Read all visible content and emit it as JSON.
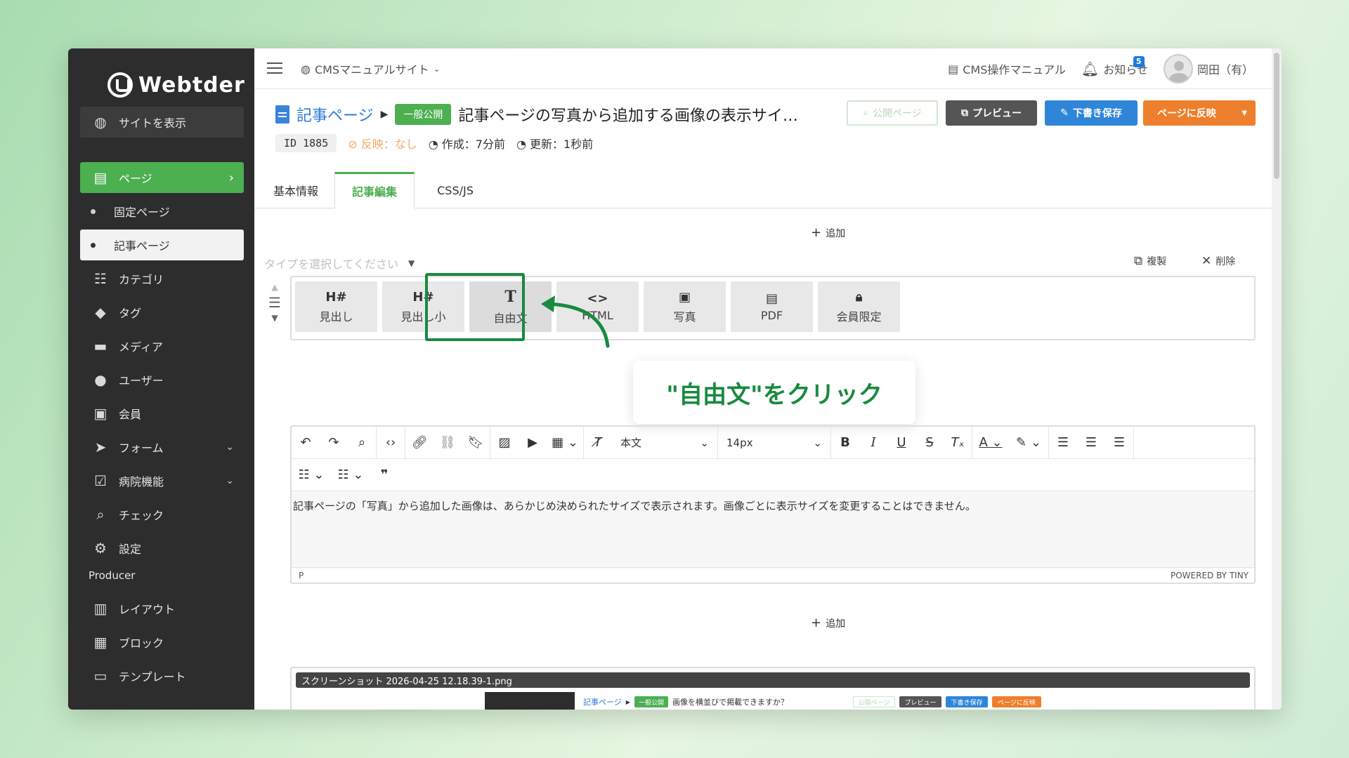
{
  "brand": {
    "name": "Webtder"
  },
  "sidebar": {
    "site_view": "サイトを表示",
    "items": [
      {
        "label": "ページ",
        "icon": "page-icon"
      },
      {
        "label": "固定ページ"
      },
      {
        "label": "記事ページ"
      },
      {
        "label": "カテゴリ",
        "icon": "category-icon"
      },
      {
        "label": "タグ",
        "icon": "tag-icon"
      },
      {
        "label": "メディア",
        "icon": "folder-icon"
      },
      {
        "label": "ユーザー",
        "icon": "user-icon"
      },
      {
        "label": "会員",
        "icon": "member-card-icon"
      },
      {
        "label": "フォーム",
        "icon": "send-icon"
      },
      {
        "label": "病院機能",
        "icon": "clipboard-check-icon"
      },
      {
        "label": "チェック",
        "icon": "search-icon"
      },
      {
        "label": "設定",
        "icon": "gear-icon"
      }
    ],
    "producer_label": "Producer",
    "producer_items": [
      {
        "label": "レイアウト",
        "icon": "layout-icon"
      },
      {
        "label": "ブロック",
        "icon": "blocks-icon"
      },
      {
        "label": "テンプレート",
        "icon": "monitor-icon"
      }
    ]
  },
  "topbar": {
    "site_name": "CMSマニュアルサイト",
    "manual": "CMS操作マニュアル",
    "notice": "お知らせ",
    "notice_count": "5",
    "user": "岡田（有）"
  },
  "header": {
    "crumb": "記事ページ",
    "status": "一般公開",
    "title": "記事ページの写真から追加する画像の表示サイ…",
    "buttons": {
      "public_page": "公開ページ",
      "preview": "プレビュー",
      "save_draft": "下書き保存",
      "reflect": "ページに反映"
    },
    "id": "ID 1885",
    "reflect_state": "反映：なし",
    "created": "作成：7分前",
    "updated": "更新：1秒前"
  },
  "tabs": [
    "基本情報",
    "記事編集",
    "CSS/JS"
  ],
  "editor_area": {
    "add": "追加",
    "type_placeholder": "タイプを選択してください",
    "copy": "複製",
    "delete": "削除",
    "block_types": [
      {
        "icon": "H#",
        "label": "見出し"
      },
      {
        "icon": "H#",
        "label": "見出し小"
      },
      {
        "icon": "T",
        "label": "自由文"
      },
      {
        "icon": "<>",
        "label": "HTML"
      },
      {
        "icon": "photo-file-icon",
        "label": "写真"
      },
      {
        "icon": "pdf-file-icon",
        "label": "PDF"
      },
      {
        "icon": "lock-icon",
        "label": "会員限定"
      }
    ],
    "callout": "\"自由文\"をクリック",
    "toolbar": {
      "block_format": "本文",
      "font_size": "14px"
    },
    "body_text": "記事ページの「写真」から追加した画像は、あらかじめ決められたサイズで表示されます。画像ごとに表示サイズを変更することはできません。",
    "status_path": "P",
    "powered": "POWERED BY TINY",
    "image_caption": "スクリーンショット 2026-04-25 12.18.39-1.png",
    "thumb": {
      "crumb": "記事ページ",
      "status": "一般公開",
      "title": "画像を横並びで掲載できますか？",
      "public_page": "公開ページ",
      "preview": "プレビュー",
      "save_draft": "下書き保存",
      "reflect": "ページに反映"
    }
  },
  "colors": {
    "accent_green": "#4caf50",
    "callout_green": "#198a40",
    "primary_blue": "#2f86d9",
    "orange": "#ee7f2c",
    "sidebar_bg": "#2d2d2d"
  }
}
